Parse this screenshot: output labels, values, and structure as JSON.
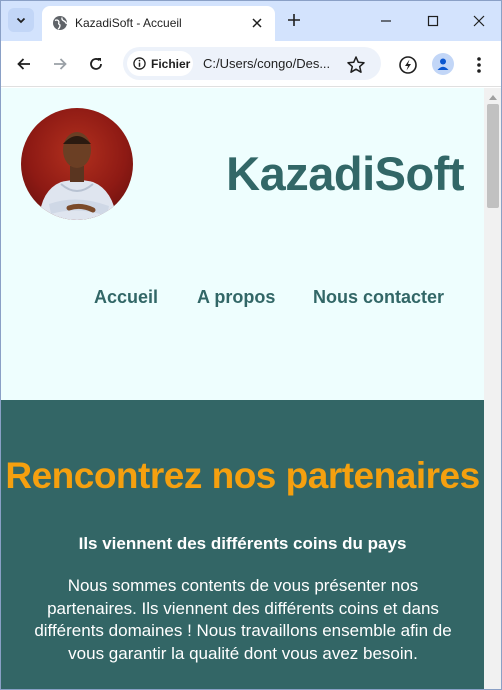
{
  "browser": {
    "tab_title": "KazadiSoft - Accueil",
    "chip_label": "Fichier",
    "url": "C:/Users/congo/Des...",
    "icons": {
      "tab_search": "chevron-down-icon",
      "favicon": "globe-icon",
      "close": "close-icon",
      "new_tab": "plus-icon",
      "minimize": "minimize-icon",
      "maximize": "maximize-icon",
      "window_close": "close-icon",
      "back": "back-arrow-icon",
      "forward": "forward-arrow-icon",
      "reload": "reload-icon",
      "info": "info-icon",
      "bookmark": "star-icon",
      "extension": "extension-icon",
      "profile": "profile-icon",
      "menu": "more-vert-icon"
    }
  },
  "page": {
    "brand": "KazadiSoft",
    "nav": [
      "Accueil",
      "A propos",
      "Nous contacter"
    ],
    "partners": {
      "heading": "Rencontrez nos partenaires",
      "subheading": "Ils viennent des différents coins du pays",
      "paragraph": "Nous sommes contents de vous présenter nos partenaires. Ils viennent des différents coins et dans différents domaines ! Nous travaillons ensemble afin de vous garantir la qualité dont vous avez besoin."
    },
    "colors": {
      "header_bg": "#eefefe",
      "brand_text": "#326767",
      "section_bg": "#336666",
      "heading_orange": "#f5a00f"
    }
  }
}
